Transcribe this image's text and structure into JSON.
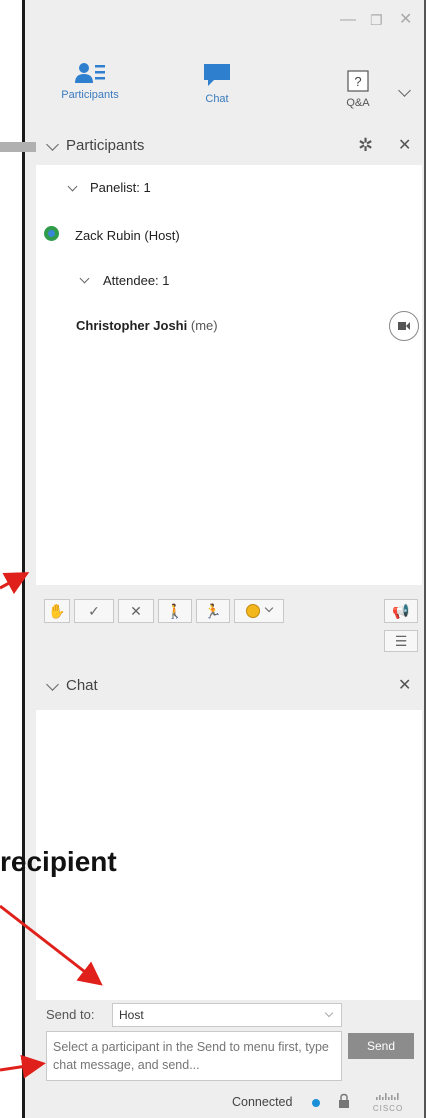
{
  "tabs": [
    {
      "label": "Participants",
      "icon": "participants-icon"
    },
    {
      "label": "Chat",
      "icon": "chat-bubble-icon"
    },
    {
      "label": "Q&A",
      "icon": "question-icon"
    }
  ],
  "participants_panel": {
    "title": "Participants",
    "groups": {
      "panelist": "Panelist: 1",
      "attendee": "Attendee: 1"
    },
    "host": "Zack Rubin (Host)",
    "me_name": "Christopher Joshi",
    "me_suffix": "(me)"
  },
  "chat_panel": {
    "title": "Chat"
  },
  "send": {
    "label": "Send to:",
    "selected": "Host",
    "placeholder": "Select a participant in the Send to menu first, type chat message, and send...",
    "button": "Send"
  },
  "status": {
    "text": "Connected",
    "brand": "cisco"
  },
  "annotation": {
    "text": "recipient"
  },
  "colors": {
    "accent": "#2f7fcf",
    "arrow": "#e0201b",
    "connected": "#1a8fd8"
  }
}
